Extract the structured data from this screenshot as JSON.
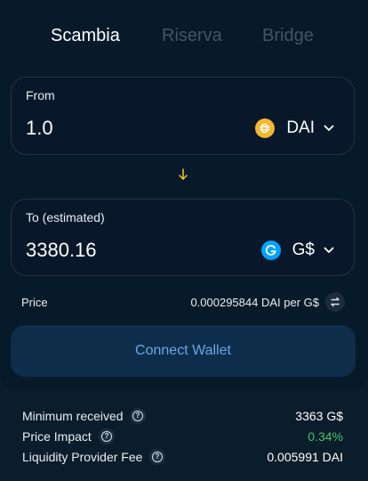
{
  "tabs": [
    {
      "label": "Scambia",
      "active": true
    },
    {
      "label": "Riserva",
      "active": false
    },
    {
      "label": "Bridge",
      "active": false
    }
  ],
  "from": {
    "label": "From",
    "amount": "1.0",
    "token": {
      "name": "DAI",
      "icon": "dai-token-icon",
      "color": "#f4b731"
    }
  },
  "to": {
    "label": "To (estimated)",
    "amount": "3380.16",
    "token": {
      "name": "G$",
      "icon": "gooddollar-token-icon",
      "color": "#00a3ff"
    }
  },
  "swap_arrow": {
    "icon": "arrow-down-icon",
    "color": "#f4c430"
  },
  "price": {
    "label": "Price",
    "value": "0.000295844 DAI per G$",
    "switch_icon": "swap-rate-icon"
  },
  "connect_button": {
    "label": "Connect Wallet"
  },
  "details": [
    {
      "label": "Minimum received",
      "value": "3363 G$",
      "value_color": "#ffffff"
    },
    {
      "label": "Price Impact",
      "value": "0.34%",
      "value_color": "#3fc46e"
    },
    {
      "label": "Liquidity Provider Fee",
      "value": "0.005991 DAI",
      "value_color": "#ffffff"
    }
  ],
  "colors": {
    "background": "#0b1c2a",
    "card": "#071a2a",
    "button_bg": "#0d2d4b",
    "button_text": "#6aa7e6",
    "inactive_tab": "#3f5566"
  }
}
